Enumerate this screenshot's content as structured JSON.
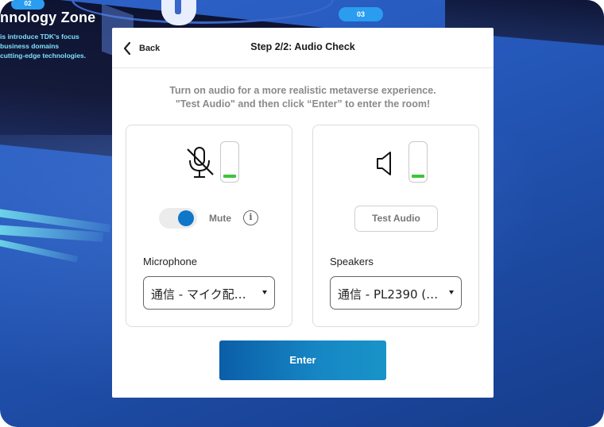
{
  "background": {
    "zone_badge": "02",
    "zone_title": "nnology Zone",
    "zone_desc_lines": [
      "is introduce TDK's focus",
      "business domains",
      "cutting-edge technologies."
    ],
    "badge_03": "03"
  },
  "header": {
    "back_label": "Back",
    "title": "Step 2/2: Audio Check"
  },
  "instructions": {
    "line1": "Turn on audio for a more realistic metaverse experience.",
    "line2": "\"Test Audio\" and then click “Enter” to enter the room!"
  },
  "microphone": {
    "icon": "microphone-muted-icon",
    "level": 0.1,
    "mute_label": "Mute",
    "mute_on": true,
    "info_icon": "info-icon",
    "info_glyph": "i",
    "field_label": "Microphone",
    "selected": "通信 - マイク配…"
  },
  "speakers": {
    "icon": "speaker-icon",
    "level": 0.1,
    "test_label": "Test Audio",
    "field_label": "Speakers",
    "selected": "通信 - PL2390 (…"
  },
  "enter_label": "Enter",
  "colors": {
    "accent": "#0f77c8",
    "level_green": "#3ec43e",
    "enter_gradient_start": "#0b5ea8",
    "enter_gradient_end": "#1894c8"
  }
}
